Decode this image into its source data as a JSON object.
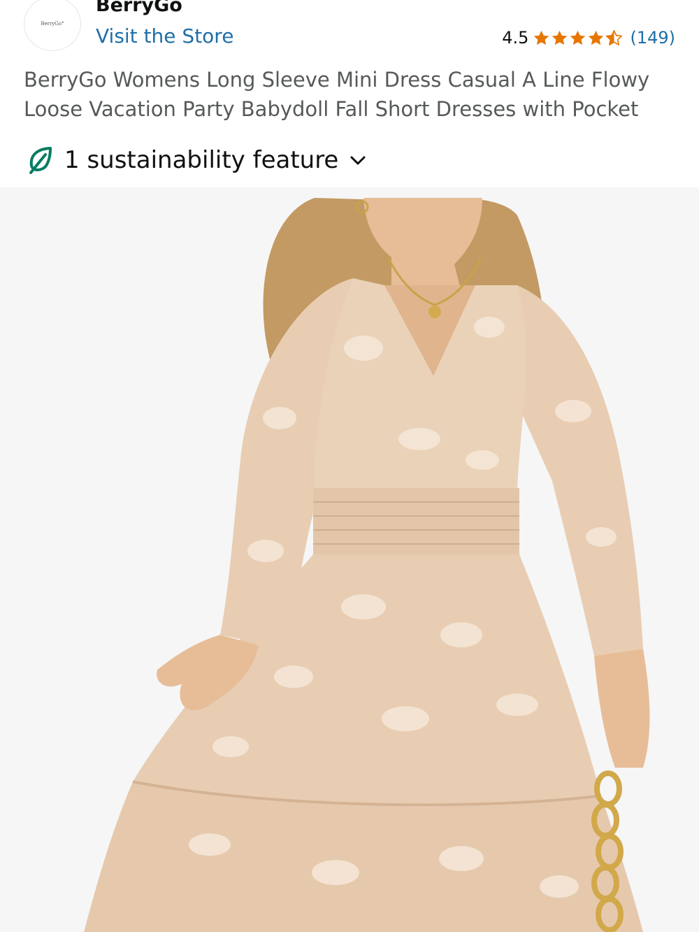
{
  "brand": {
    "logo_text": "BerryGo°",
    "name": "BerryGo",
    "visit_store": "Visit the Store"
  },
  "rating": {
    "value": "4.5",
    "stars": 4.5,
    "count": "(149)",
    "star_color": "#e77600"
  },
  "product": {
    "title": "BerryGo Womens Long Sleeve Mini Dress Casual A Line Flowy Loose Vacation Party Babydoll Fall Short Dresses with Pocket"
  },
  "sustainability": {
    "label": "1 sustainability feature",
    "icon": "leaf-icon",
    "accent": "#067d62"
  },
  "image": {
    "subject": "model-wearing-beige-floral-dress"
  },
  "colors": {
    "link": "#1f6fa8",
    "dress": "#e8cdb3"
  }
}
